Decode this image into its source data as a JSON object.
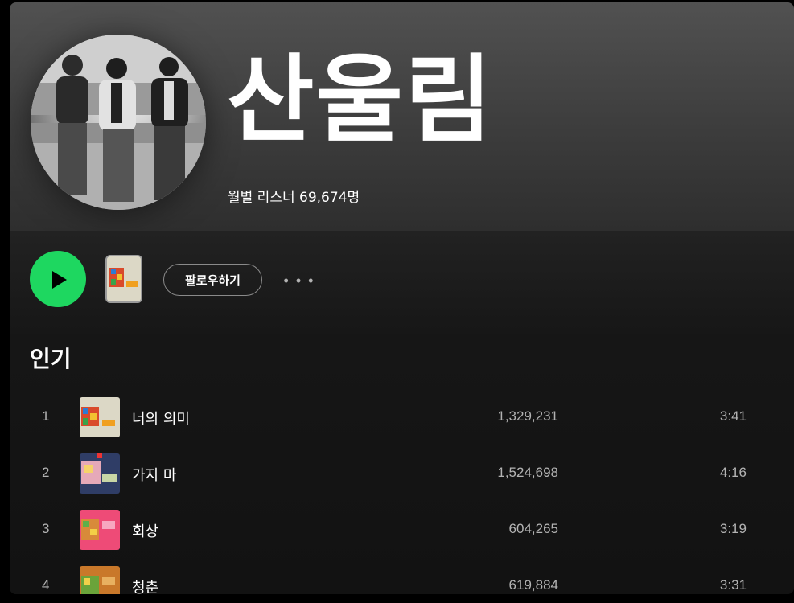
{
  "artist": {
    "name": "산울림",
    "monthly_listeners": "월별 리스너 69,674명"
  },
  "actions": {
    "follow_label": "팔로우하기",
    "more_label": "• • •"
  },
  "popular": {
    "title": "인기",
    "tracks": [
      {
        "rank": "1",
        "title": "너의 의미",
        "plays": "1,329,231",
        "duration": "3:41"
      },
      {
        "rank": "2",
        "title": "가지 마",
        "plays": "1,524,698",
        "duration": "4:16"
      },
      {
        "rank": "3",
        "title": "회상",
        "plays": "604,265",
        "duration": "3:19"
      },
      {
        "rank": "4",
        "title": "청춘",
        "plays": "619,884",
        "duration": "3:31"
      }
    ]
  },
  "colors": {
    "accent": "#1ed760",
    "background": "#121212",
    "muted_text": "#b3b3b3"
  }
}
